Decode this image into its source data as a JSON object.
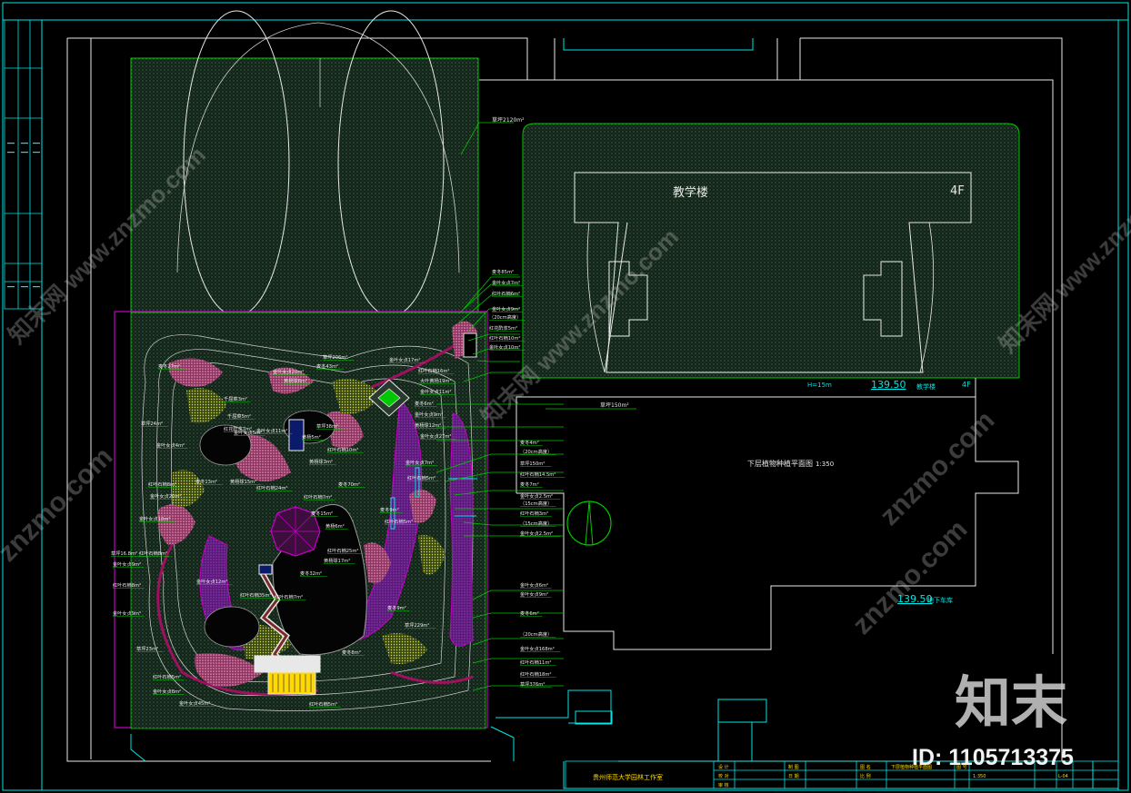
{
  "drawing": {
    "teaching_building": "教学楼",
    "floors_tag": "4F",
    "floors_tag_2": "4F",
    "elevation_1": "139.50",
    "elevation_2": "139.50",
    "elevation_note_1": "教学楼",
    "elevation_note_2": "地下车库",
    "plan_title": "下层植物种植平面图",
    "plan_scale": "1:350",
    "height_note": "H=15m",
    "lawn_area": "草坪2120m²",
    "lawn_area_2": "草坪150m²"
  },
  "callouts": [
    "麦冬85m²",
    "金叶女贞7m²",
    "红叶石楠6m²",
    "金叶女贞9m²",
    "（20cm高度）",
    "红花酢浆5m²",
    "红叶石楠10m²",
    "金叶女贞10m²",
    "金叶女贞17m²",
    "红叶石楠16m²",
    "大叶黄杨19m²",
    "金叶女贞11m²",
    "麦冬6m²",
    "金叶女贞9m²",
    "黄杨球12m²",
    "金叶女贞27m²",
    "麦冬4m²",
    "（20cm高度）",
    "草坪150m²",
    "红叶石楠14.5m²",
    "麦冬7m²",
    "金叶女贞2.5m²",
    "（15cm高度）",
    "红叶石楠3m²",
    "（15cm高度）",
    "金叶女贞2.5m²",
    "金叶女贞6m²",
    "金叶女贞9m²",
    "麦冬6m²",
    "（20cm高度）",
    "金叶女贞168m²",
    "红叶石楠11m²",
    "红叶石楠18m²",
    "草坪376m²"
  ],
  "left_callouts": [
    "麦冬27m²",
    "草坪24m²",
    "金叶女贞4m²",
    "红叶石楠8m²",
    "金叶女贞20m²",
    "金叶女贞10m²",
    "红叶石楠8m²",
    "草坪16.8m²",
    "金叶女贞9m²",
    "红叶石楠8m²",
    "金叶女贞9m²",
    "草坪23m²",
    "红叶石楠5m²",
    "金叶女贞8m²",
    "金叶女贞45m²"
  ],
  "inner_callouts": [
    "金叶女贞20m²",
    "黄杨球6m²",
    "草坪206m²",
    "麦冬43m²",
    "千屈菜3m²",
    "千屈菜5m²",
    "红花酢浆7m²",
    "金叶女贞5m²",
    "金叶女贞11m²",
    "草坪38m²",
    "黄杨5m²",
    "红叶石楠10m²",
    "黄杨球3m²",
    "麦冬70m²",
    "麦冬9m²",
    "红叶石楠5m²",
    "金叶女贞7m²",
    "红叶石楠5m²",
    "麦冬13m²",
    "黄杨球15m²",
    "红叶石楠24m²",
    "红叶石楠7m²",
    "麦冬15m²",
    "黄杨6m²",
    "红叶石楠25m²",
    "黄杨球17m²",
    "麦冬32m²",
    "金叶女贞12m²",
    "红叶石楠35m²",
    "红叶石楠7m²",
    "麦冬9m²",
    "草坪229m²",
    "麦冬8m²",
    "红叶石楠5m²"
  ],
  "title_block": {
    "institute": "贵州师范大学园林工作室",
    "cells": [
      "设 计",
      "校 对",
      "审 核",
      "制 图",
      "日 期",
      "图 名",
      "比 例",
      "图 号",
      "下层植物种植平面图",
      "1:350",
      "L-04"
    ]
  },
  "watermark": {
    "brand_cn": "知末",
    "brand_site": "znzmo.com",
    "brand_cn_long": "知末网 www.znzmo.com",
    "id_label": "ID: 1105713375"
  },
  "colors": {
    "cyan": "#00e5e5",
    "green": "#00c800",
    "white": "#e8e8e8",
    "magenta": "#c400c4",
    "pink": "#ff7fb4",
    "yellow": "#ffd800",
    "dark_green_fill": "#1a2a1e"
  }
}
